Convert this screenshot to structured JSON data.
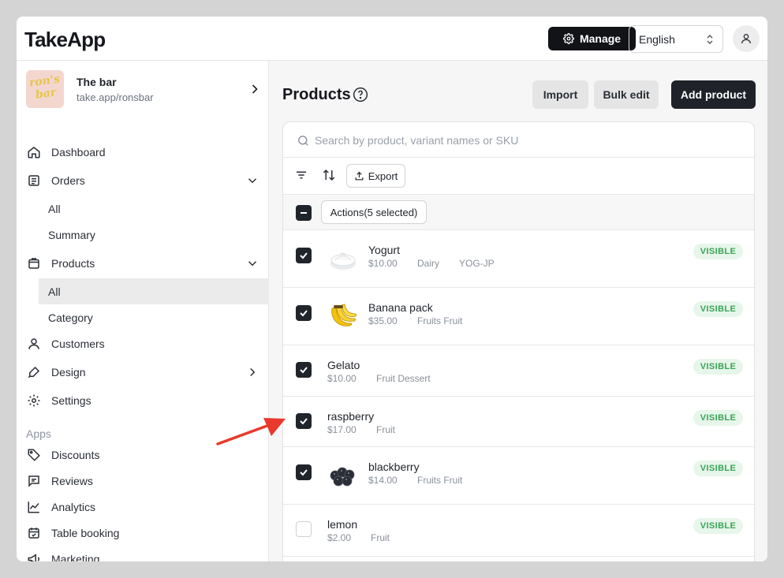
{
  "header": {
    "logo": "TakeApp",
    "manage_label": "Manage",
    "language": "English"
  },
  "store": {
    "name": "The bar",
    "url": "take.app/ronsbar",
    "thumb_text_1": "ron's",
    "thumb_text_2": "bar"
  },
  "sidebar": {
    "dashboard": "Dashboard",
    "orders": "Orders",
    "orders_all": "All",
    "orders_summary": "Summary",
    "products": "Products",
    "products_all": "All",
    "products_category": "Category",
    "customers": "Customers",
    "design": "Design",
    "settings": "Settings",
    "apps_label": "Apps",
    "discounts": "Discounts",
    "reviews": "Reviews",
    "analytics": "Analytics",
    "table_booking": "Table booking",
    "marketing": "Marketing"
  },
  "page": {
    "title": "Products",
    "import_label": "Import",
    "bulk_edit_label": "Bulk edit",
    "add_product_label": "Add product",
    "search_placeholder": "Search by product, variant names or SKU",
    "export_label": "Export",
    "actions_label": "Actions(5 selected)"
  },
  "products": [
    {
      "name": "Yogurt",
      "price": "$10.00",
      "meta1": "Dairy",
      "meta2": "YOG-JP",
      "status": "VISIBLE",
      "checked": true,
      "thumb": "yogurt-image"
    },
    {
      "name": "Banana pack",
      "price": "$35.00",
      "meta1": "Fruits Fruit",
      "meta2": "",
      "status": "VISIBLE",
      "checked": true,
      "thumb": "banana-image"
    },
    {
      "name": "Gelato",
      "price": "$10.00",
      "meta1": "Fruit Dessert",
      "meta2": "",
      "status": "VISIBLE",
      "checked": true,
      "thumb": ""
    },
    {
      "name": "raspberry",
      "price": "$17.00",
      "meta1": "Fruit",
      "meta2": "",
      "status": "VISIBLE",
      "checked": true,
      "thumb": ""
    },
    {
      "name": "blackberry",
      "price": "$14.00",
      "meta1": "Fruits Fruit",
      "meta2": "",
      "status": "VISIBLE",
      "checked": true,
      "thumb": "blackberry-image"
    },
    {
      "name": "lemon",
      "price": "$2.00",
      "meta1": "Fruit",
      "meta2": "",
      "status": "VISIBLE",
      "checked": false,
      "thumb": ""
    }
  ],
  "colors": {
    "accent_dark": "#1f2329",
    "visible_badge_bg": "#e7f6ea",
    "visible_badge_text": "#39a556",
    "annotation_arrow": "#e8392c"
  }
}
